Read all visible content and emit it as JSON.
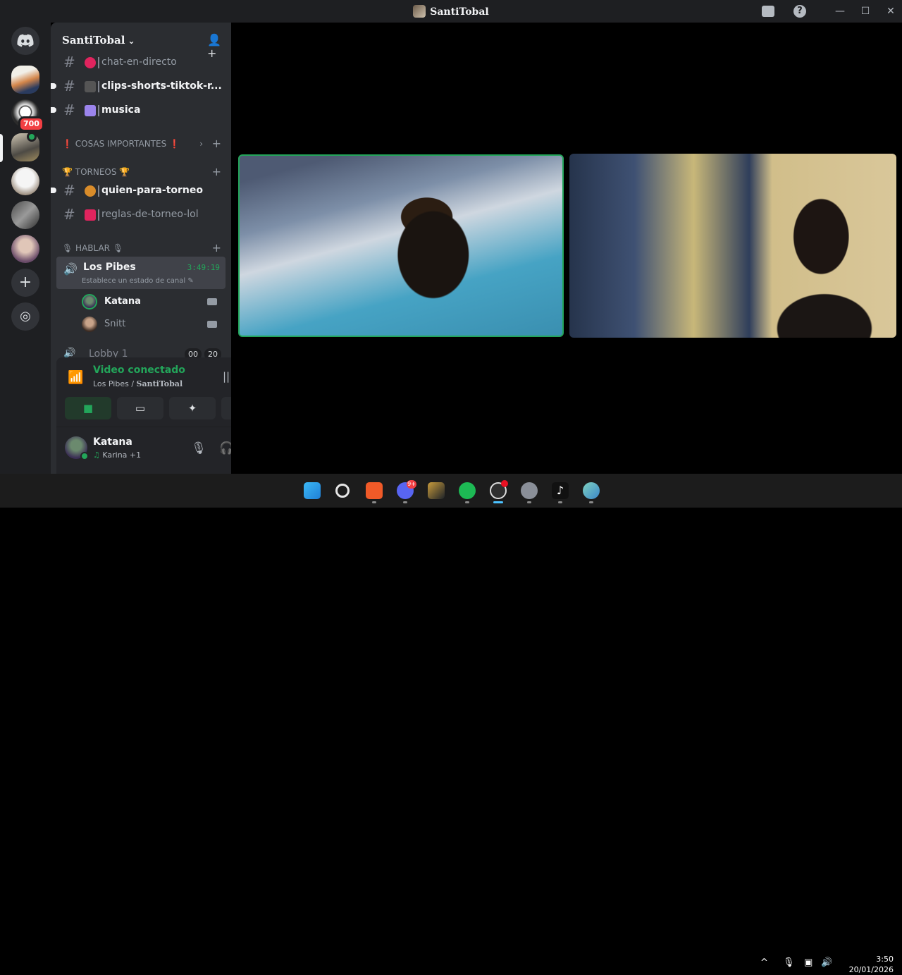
{
  "window": {
    "title": "SantiTobal",
    "controls": [
      "minimize",
      "maximize",
      "close"
    ]
  },
  "guilds": {
    "mention_badge": "700"
  },
  "server": {
    "name": "SantiTobal"
  },
  "channels": {
    "chat": {
      "name": "chat-en-directo"
    },
    "clips": {
      "name": "clips-shorts-tiktok-r..."
    },
    "musica": {
      "name": "musica"
    },
    "cat_importantes": "❗ COSAS IMPORTANTES ❗",
    "cat_torneos": "🏆 TORNEOS 🏆",
    "quien": {
      "name": "quien-para-torneo"
    },
    "reglas": {
      "name": "reglas-de-torneo-lol"
    },
    "cat_hablar": "🎙 HABLAR 🎙"
  },
  "voice_channel": {
    "name": "Los Pibes",
    "timer": "3:49:19",
    "status_hint": "Establece un estado de canal ✎",
    "users": [
      {
        "name": "Katana"
      },
      {
        "name": "Snitt"
      }
    ],
    "lobby": {
      "name": "Lobby 1",
      "count_a": "00",
      "count_b": "20"
    }
  },
  "voice_panel": {
    "status": "Video conectado",
    "channel": "Los Pibes / ",
    "server": "SantiTobal"
  },
  "user_panel": {
    "name": "Katana",
    "activity": "Karina +1"
  },
  "taskbar": {
    "discord_badge": "9+",
    "time": "3:50",
    "date": "20/01/2026"
  },
  "colors": {
    "accent_green": "#23a55a",
    "sidebar_bg": "#2b2d31",
    "guild_bg": "#1e1f22",
    "badge_red": "#f23f43"
  }
}
